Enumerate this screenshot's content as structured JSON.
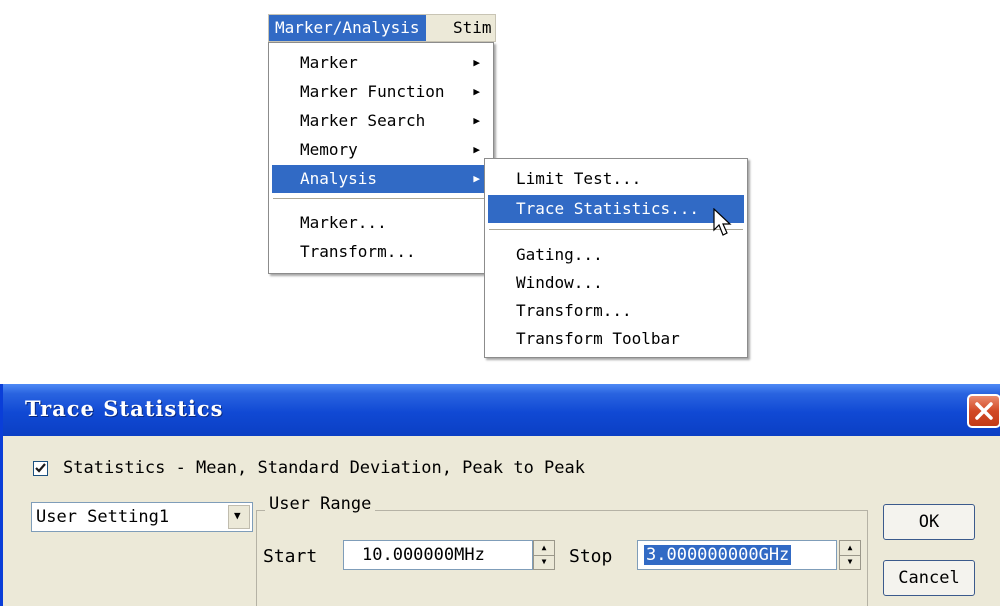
{
  "menubar": {
    "active": "Marker/Analysis",
    "next": "Stim"
  },
  "main_menu": {
    "items": [
      {
        "label": "Marker",
        "has_submenu": true,
        "highlighted": false
      },
      {
        "label": "Marker Function",
        "has_submenu": true,
        "highlighted": false
      },
      {
        "label": "Marker Search",
        "has_submenu": true,
        "highlighted": false
      },
      {
        "label": "Memory",
        "has_submenu": true,
        "highlighted": false
      },
      {
        "label": "Analysis",
        "has_submenu": true,
        "highlighted": true
      },
      {
        "label": "Marker...",
        "has_submenu": false,
        "highlighted": false
      },
      {
        "label": "Transform...",
        "has_submenu": false,
        "highlighted": false
      }
    ]
  },
  "analysis_submenu": {
    "items": [
      {
        "label": "Limit Test...",
        "highlighted": false
      },
      {
        "label": "Trace Statistics...",
        "highlighted": true
      },
      {
        "label": "Gating...",
        "highlighted": false
      },
      {
        "label": "Window...",
        "highlighted": false
      },
      {
        "label": "Transform...",
        "highlighted": false
      },
      {
        "label": "Transform Toolbar",
        "highlighted": false
      }
    ]
  },
  "dialog": {
    "title": "Trace Statistics",
    "statistics_checkbox": {
      "checked": true,
      "label": "Statistics - Mean, Standard Deviation, Peak to Peak"
    },
    "setting_select": "User Setting1",
    "user_range": {
      "legend": "User Range",
      "start_label": "Start",
      "start_value": "10.000000MHz",
      "stop_label": "Stop",
      "stop_value": "3.000000000GHz"
    },
    "ok_label": "OK",
    "cancel_label": "Cancel"
  },
  "colors": {
    "selection": "#316ac5",
    "dialog_face": "#ece9d8",
    "titlebar": "#1049d4",
    "close": "#d24a26"
  }
}
